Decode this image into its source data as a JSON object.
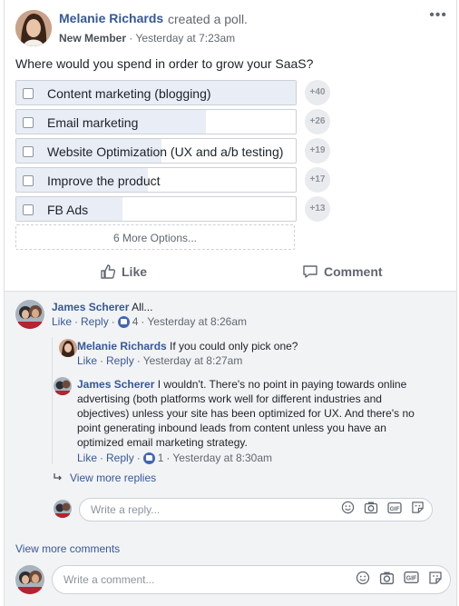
{
  "post": {
    "author": "Melanie Richards",
    "action": "created a poll.",
    "badge": "New Member",
    "separator": "·",
    "time": "Yesterday at 7:23am",
    "question": "Where would you spend in order to grow your SaaS?",
    "more_options_label": "6 More Options...",
    "like_label": "Like",
    "comment_label": "Comment"
  },
  "poll": {
    "options": [
      {
        "label": "Content marketing (blogging)",
        "count": "+40",
        "fraction": 1.0
      },
      {
        "label": "Email marketing",
        "count": "+26",
        "fraction": 0.68
      },
      {
        "label": "Website Optimization (UX and a/b testing)",
        "count": "+19",
        "fraction": 0.52
      },
      {
        "label": "Improve the product",
        "count": "+17",
        "fraction": 0.47
      },
      {
        "label": "FB Ads",
        "count": "+13",
        "fraction": 0.38
      }
    ]
  },
  "comments": {
    "c1": {
      "author": "James Scherer",
      "text": "All...",
      "like": "Like",
      "reply": "Reply",
      "reactions": "4",
      "time": "Yesterday at 8:26am"
    },
    "r1": {
      "author": "Melanie Richards",
      "text": "If you could only pick one?",
      "like": "Like",
      "reply": "Reply",
      "time": "Yesterday at 8:27am"
    },
    "r2": {
      "author": "James Scherer",
      "text_l1": "I wouldn't. There's no point in paying towards online",
      "text_l2": "advertising (both platforms work well for different industries and",
      "text_l3": "objectives) unless your site has been optimized for UX. And there's no",
      "text_l4": "point generating inbound leads from content unless you have an",
      "text_l5": "optimized email marketing strategy.",
      "like": "Like",
      "reply": "Reply",
      "reactions": "1",
      "time": "Yesterday at 8:30am"
    },
    "view_more_replies": "View more replies",
    "reply_placeholder": "Write a reply...",
    "view_more_comments": "View more comments",
    "comment_placeholder": "Write a comment..."
  },
  "colors": {
    "link": "#365899",
    "like_blue": "#4267b2",
    "poll_fill": "#e9edf6"
  }
}
